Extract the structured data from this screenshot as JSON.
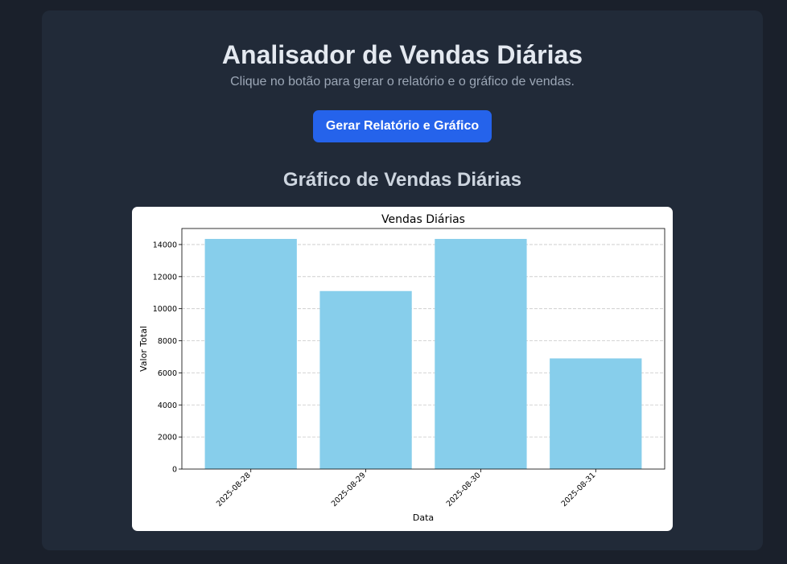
{
  "page": {
    "title": "Analisador de Vendas Diárias",
    "subtitle": "Clique no botão para gerar o relatório e o gráfico de vendas.",
    "button_label": "Gerar Relatório e Gráfico",
    "section_title": "Gráfico de Vendas Diárias"
  },
  "colors": {
    "background": "#1a202b",
    "card": "#212a38",
    "button": "#2563eb",
    "bar": "#87ceeb"
  },
  "chart_data": {
    "type": "bar",
    "title": "Vendas Diárias",
    "xlabel": "Data",
    "ylabel": "Valor Total",
    "categories": [
      "2025-08-28",
      "2025-08-29",
      "2025-08-30",
      "2025-08-31"
    ],
    "values": [
      14350,
      11100,
      14350,
      6900
    ],
    "ylim": [
      0,
      15000
    ],
    "yticks": [
      0,
      2000,
      4000,
      6000,
      8000,
      10000,
      12000,
      14000
    ],
    "grid": "y-dashed",
    "bar_color": "#87ceeb",
    "xtick_rotation": 45
  }
}
